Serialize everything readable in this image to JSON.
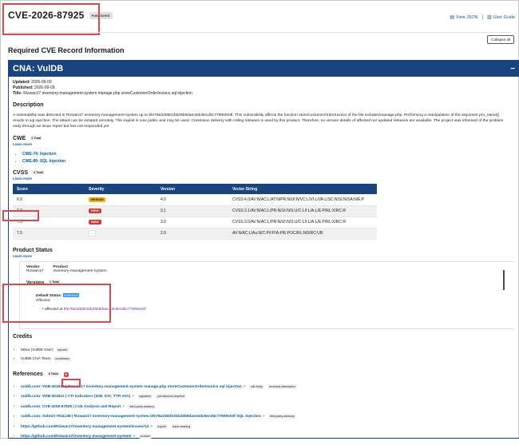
{
  "header": {
    "cve_id": "CVE-2026-87925",
    "status_badge": "PUBLISHED",
    "view_json": "View JSON",
    "user_guide": "User Guide",
    "separator": "|",
    "collapse_all": "Collapse all"
  },
  "required_title": "Required CVE Record Information",
  "cna": {
    "title": "CNA: VulDB",
    "collapse_symbol": "−",
    "updated_label": "Updated:",
    "updated_value": "2026-09-09",
    "published_label": "Published:",
    "published_value": "2026-09-09",
    "title_label": "Title:",
    "title_value": "Rizwan17 inventory-management-system manage.php storeCustomerOrderInvoice sql injection"
  },
  "description": {
    "heading": "Description",
    "text": "A vulnerability was detected in Rizwan17 inventory-management-system up to bfe78a330d01bb26b9daec5dc9ecd5c77900e03f. This vulnerability affects the function storeCustomerOrderInvoice of the file includes/manage.php. Performing a manipulation of the argument pro_name[] results in sql injection. The attack can be initiated remotely. The exploit is now public and may be used. Continious delivery with rolling releases is used by this product. Therefore, no version details of affected nor updated releases are available. The project was informed of the problem early through an issue report but has not responded yet."
  },
  "cwe": {
    "heading": "CWE",
    "count": "2 Total",
    "learn_more": "Learn more",
    "items": [
      "CWE-74: Injection",
      "CWE-89: SQL Injection"
    ]
  },
  "cvss": {
    "heading": "CVSS",
    "count": "4 Total",
    "learn_more": "Learn more",
    "columns": [
      "Score",
      "Severity",
      "Version",
      "Vector String"
    ],
    "rows": [
      {
        "score": "6.9",
        "severity": "MEDIUM",
        "version": "4.0",
        "vector": "CVSS:4.0/AV:N/AC:L/AT:N/PR:N/UI:N/VC:L/VI:L/VA:L/SC:N/SI:N/SA:N/E:P"
      },
      {
        "score": "7.3",
        "severity": "HIGH",
        "version": "3.1",
        "vector": "CVSS:3.1/AV:N/AC:L/PR:N/UI:N/S:U/C:L/I:L/A:L/E:P/RL:X/RC:R"
      },
      {
        "score": "7.3",
        "severity": "HIGH",
        "version": "3.0",
        "vector": "CVSS:3.0/AV:N/AC:L/PR:N/UI:N/S:U/C:L/I:L/A:L/E:P/RL:X/RC:R"
      },
      {
        "score": "7.5",
        "severity": "-",
        "version": "2.0",
        "vector": "AV:N/AC:L/Au:N/C:P/I:P/A:P/E:POC/RL:ND/RC:UR"
      }
    ]
  },
  "product_status": {
    "heading": "Product Status",
    "learn_more": "Learn more",
    "vendor_label": "Vendor",
    "vendor_value": "Rizwan17",
    "product_label": "Product",
    "product_value": "inventory-management-system",
    "versions_label": "Versions",
    "versions_count": "1 Total",
    "default_status_label": "Default Status:",
    "default_status_value": "unknown",
    "affected_label": "Affected",
    "affected_at_label": "affected at",
    "affected_at_value": "bfe78a330d01bb26b9daec5dc9ecd5c77900e03f"
  },
  "credits": {
    "heading": "Credits",
    "items": [
      {
        "name": "Miisa (VulDB User)",
        "role": "reporter"
      },
      {
        "name": "VulDB CNA Team",
        "role": "coordinator"
      }
    ]
  },
  "references": {
    "heading": "References",
    "count": "8 Total",
    "red_badge": "▾",
    "items": [
      {
        "text": "vuldb.com: VDB-401912 | Rizwan17 inventory-management-system manage.php storeCustomerOrderInvoice sql injection",
        "tags": [
          "vdb-entry",
          "technical-description"
        ]
      },
      {
        "text": "vuldb.com: VDB-401912 | CTI Indicators (IOB, IOC, TTP, IOA)",
        "tags": [
          "signature",
          "permissions-required"
        ]
      },
      {
        "text": "vuldb.com: CVE-2026-87925 | CVE Analysis and Report",
        "tags": [
          "third-party-advisory"
        ]
      },
      {
        "text": "vuldb.com: Submit #911138 | Rizwan17 inventory-management-system bfe78a330d01bb26b9daec5dc9ecd5c77900e03f SQL Injection",
        "tags": [
          "third-party-advisory"
        ]
      },
      {
        "text": "https://github.com/Rizwan17/inventory-management-system/issues/13",
        "tags": [
          "exploit",
          "issue-tracking"
        ]
      },
      {
        "text": "https://github.com/Rizwan17/inventory-management-system/",
        "tags": [
          "product"
        ]
      }
    ]
  }
}
